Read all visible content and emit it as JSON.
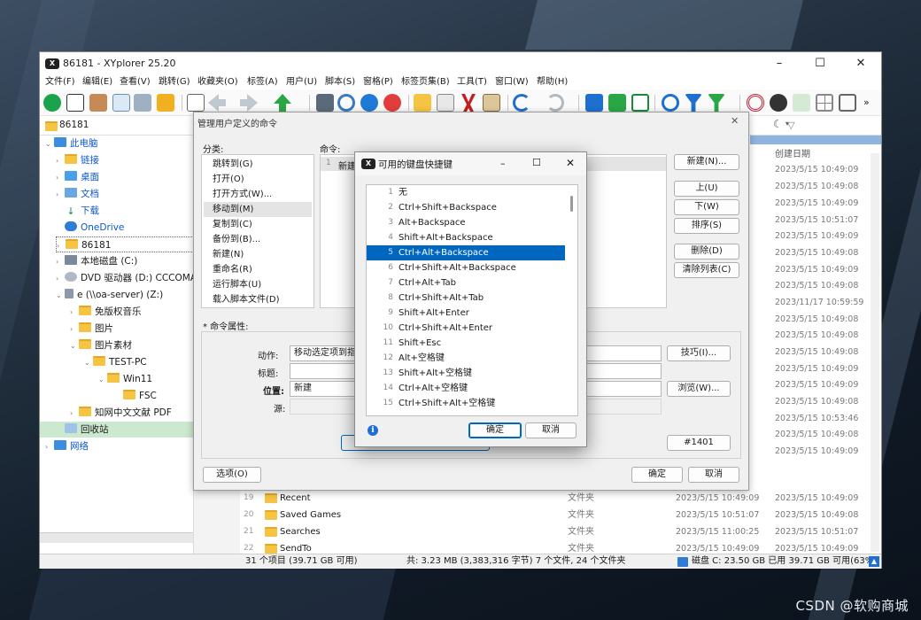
{
  "window": {
    "title": "86181 - XYplorer 25.20",
    "minimize": "–",
    "maximize": "☐",
    "close": "✕"
  },
  "menu": [
    "文件(F)",
    "编辑(E)",
    "查看(V)",
    "跳转(G)",
    "收藏夹(O)",
    "标签(A)",
    "用户(U)",
    "脚本(S)",
    "窗格(P)",
    "标签页集(B)",
    "工具(T)",
    "窗口(W)",
    "帮助(H)"
  ],
  "toolbar": {
    "more": "»"
  },
  "address": {
    "path": "86181",
    "right_path": "86181"
  },
  "tree": [
    {
      "label": "此电脑",
      "icon": "computer-icon"
    },
    {
      "label": "链接",
      "icon": "folder-icon"
    },
    {
      "label": "桌面",
      "icon": "desktop-icon"
    },
    {
      "label": "文档",
      "icon": "documents-icon"
    },
    {
      "label": "下载",
      "icon": "download-icon"
    },
    {
      "label": "OneDrive",
      "icon": "cloud-icon"
    },
    {
      "label": "86181",
      "icon": "folder-icon"
    },
    {
      "label": "本地磁盘 (C:)",
      "icon": "drive-icon"
    },
    {
      "label": "DVD 驱动器 (D:) CCCOMA_X",
      "icon": "dvd-icon"
    },
    {
      "label": "e (\\\\oa-server) (Z:)",
      "icon": "network-drive-icon"
    },
    {
      "label": "免版权音乐",
      "icon": "folder-icon"
    },
    {
      "label": "图片",
      "icon": "folder-icon"
    },
    {
      "label": "图片素材",
      "icon": "folder-icon"
    },
    {
      "label": "TEST-PC",
      "icon": "folder-icon"
    },
    {
      "label": "Win11",
      "icon": "folder-icon"
    },
    {
      "label": "FSC",
      "icon": "folder-icon"
    },
    {
      "label": "知网中文文献 PDF",
      "icon": "folder-icon"
    },
    {
      "label": "回收站",
      "icon": "recycle-bin-icon"
    },
    {
      "label": "网络",
      "icon": "network-icon"
    }
  ],
  "list": {
    "column_created": "创建日期",
    "created_dates": [
      "2023/5/15 10:49:09",
      "2023/5/15 10:49:08",
      "2023/5/15 10:49:09",
      "2023/5/15 10:51:07",
      "2023/5/15 10:49:09",
      "2023/5/15 10:49:08",
      "2023/5/15 10:49:09",
      "2023/5/15 10:49:08",
      "2023/11/17 10:59:59",
      "2023/5/15 10:49:08",
      "2023/5/15 10:49:08",
      "2023/5/15 10:49:08",
      "2023/5/15 10:49:09",
      "2023/5/15 10:49:09",
      "2023/5/15 10:49:08",
      "2023/5/15 10:53:46",
      "2023/5/15 10:49:08",
      "2023/5/15 10:49:09"
    ],
    "rows": [
      {
        "num": "19",
        "name": "Recent",
        "type": "文件夹",
        "modified": "2023/5/15 10:49:09",
        "created": "2023/5/15 10:49:09"
      },
      {
        "num": "20",
        "name": "Saved Games",
        "type": "文件夹",
        "modified": "2023/5/15 10:51:07",
        "created": "2023/5/15 10:49:08"
      },
      {
        "num": "21",
        "name": "Searches",
        "type": "文件夹",
        "modified": "2023/5/15 11:00:25",
        "created": "2023/5/15 10:51:07"
      },
      {
        "num": "22",
        "name": "SendTo",
        "type": "文件夹",
        "modified": "2023/5/15 10:49:09",
        "created": "2023/5/15 10:49:09"
      }
    ]
  },
  "status": {
    "items": "31 个项目 (39.71 GB 可用)",
    "total": "共: 3.23 MB (3,383,316 字节)  7 个文件, 24 个文件夹",
    "disk": "磁盘 C:  23.50 GB 已用   39.71 GB 可用(63%)"
  },
  "manage_dialog": {
    "title": "管理用户定义的命令",
    "close": "✕",
    "category_label": "分类:",
    "categories": [
      "跳转到(G)",
      "打开(O)",
      "打开方式(W)...",
      "移动到(M)",
      "复制到(C)",
      "备份到(B)...",
      "新建(N)",
      "重命名(R)",
      "运行脚本(U)",
      "载入脚本文件(D)"
    ],
    "selected_category": 3,
    "command_label": "命令:",
    "command_row_num": "1",
    "command_row_text": "新建",
    "buttons": {
      "new": "新建(N)...",
      "up": "上(U)",
      "down": "下(W)",
      "sort": "排序(S)",
      "delete": "删除(D)",
      "clear": "清除列表(C)"
    },
    "props_label": "* 命令属性:",
    "action_label": "动作:",
    "action_value": "移动选定项到指",
    "title_label": "标题:",
    "title_value": "",
    "location_label": "位置:",
    "location_value": "新建",
    "source_label": "源:",
    "source_value": "",
    "tips_button": "技巧(I)...",
    "browse_button": "浏览(W)...",
    "id_value": "#1401",
    "options_button": "选项(O)",
    "ok_button": "确定",
    "cancel_button": "取消"
  },
  "hotkey_dialog": {
    "title": "可用的键盘快捷键",
    "minimize": "–",
    "maximize": "☐",
    "close": "✕",
    "shortcuts": [
      {
        "num": "1",
        "key": "无"
      },
      {
        "num": "2",
        "key": "Ctrl+Shift+Backspace"
      },
      {
        "num": "3",
        "key": "Alt+Backspace"
      },
      {
        "num": "4",
        "key": "Shift+Alt+Backspace"
      },
      {
        "num": "5",
        "key": "Ctrl+Alt+Backspace"
      },
      {
        "num": "6",
        "key": "Ctrl+Shift+Alt+Backspace"
      },
      {
        "num": "7",
        "key": "Ctrl+Alt+Tab"
      },
      {
        "num": "8",
        "key": "Ctrl+Shift+Alt+Tab"
      },
      {
        "num": "9",
        "key": "Shift+Alt+Enter"
      },
      {
        "num": "10",
        "key": "Ctrl+Shift+Alt+Enter"
      },
      {
        "num": "11",
        "key": "Shift+Esc"
      },
      {
        "num": "12",
        "key": "Alt+空格键"
      },
      {
        "num": "13",
        "key": "Shift+Alt+空格键"
      },
      {
        "num": "14",
        "key": "Ctrl+Alt+空格键"
      },
      {
        "num": "15",
        "key": "Ctrl+Shift+Alt+空格键"
      }
    ],
    "selected_index": 4,
    "info_icon": "i",
    "ok_button": "确定",
    "cancel_button": "取消"
  },
  "watermark": "CSDN @软购商城",
  "colors": {
    "accent": "#0067c0",
    "selection": "#0067c0",
    "tree_selected": "#cce8cf",
    "folder": "#f5c443"
  }
}
